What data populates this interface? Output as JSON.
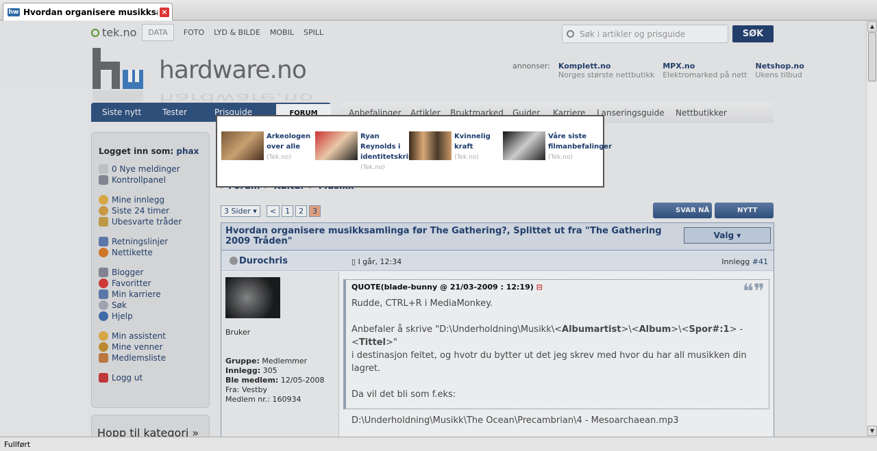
{
  "browser": {
    "tab_title": "Hvordan organisere musikksamlin...",
    "status": "Fullført"
  },
  "topnav": {
    "logo": "tek.no",
    "items": [
      "DATA",
      "FOTO",
      "LYD & BILDE",
      "MOBIL",
      "SPILL"
    ]
  },
  "search": {
    "placeholder": "Søk i artikler og prisguide",
    "button": "SØK"
  },
  "site": {
    "name": "hardware.no"
  },
  "ads": {
    "label": "annonser:",
    "items": [
      {
        "name": "Komplett.no",
        "desc": "Norges største nettbutikk"
      },
      {
        "name": "MPX.no",
        "desc": "Elektromarked på nett"
      },
      {
        "name": "Netshop.no",
        "desc": "Ukens tilbud"
      }
    ]
  },
  "nav": {
    "dark": [
      "Siste nytt",
      "Tester",
      "Prisguide"
    ],
    "forum": "FORUM",
    "light": [
      "Anbefalinger",
      "Artikler",
      "Bruktmarked",
      "Guider",
      "Karriere",
      "Lanseringsguide",
      "Nettbutikker"
    ]
  },
  "dropdown": [
    {
      "caption": "Arkeologen over alle",
      "src": "(Tek.no)"
    },
    {
      "caption": "Ryan Reynolds i identitetskrise",
      "src": "(Tek.no)"
    },
    {
      "caption": "Kvinnelig kraft",
      "src": "(Tek.no)"
    },
    {
      "caption": "Våre siste filmanbefalinger",
      "src": "(Tek.no)"
    }
  ],
  "sidebar": {
    "login_label": "Logget inn som:",
    "user": "phax",
    "links": [
      "0 Nye meldinger",
      "Kontrollpanel",
      "Mine innlegg",
      "Siste 24 timer",
      "Ubesvarte tråder",
      "Retningslinjer",
      "Nettikette",
      "Blogger",
      "Favoritter",
      "Min karriere",
      "Søk",
      "Hjelp",
      "Min assistent",
      "Mine venner",
      "Medlemsliste",
      "Logg ut"
    ],
    "jump": "Hopp til kategori »"
  },
  "breadcrumb": [
    "Forum",
    "Kultur",
    "Musikk"
  ],
  "pager": {
    "pages_label": "3 Sider",
    "prev": "<",
    "pages": [
      "1",
      "2",
      "3"
    ],
    "current": "3"
  },
  "actions": {
    "reply": "SVAR NÅ",
    "new_topic": "NYTT EMNE"
  },
  "post": {
    "title": "Hvordan organisere musikksamlinga før The Gathering?, Splittet ut fra \"The Gathering 2009 Tråden\"",
    "options": "Valg",
    "author": "Durochris",
    "time": "I går, 12:34",
    "count_label": "Innlegg",
    "count": "#41",
    "role": "Bruker",
    "group_label": "Gruppe:",
    "group": "Medlemmer",
    "posts_label": "Innlegg:",
    "posts": "305",
    "member_label": "Ble medlem:",
    "member": "12/05-2008",
    "from": "Fra: Vestby",
    "number": "Medlem nr.: 160934",
    "quote_title": "QUOTE(blade-bunny @ 21/03-2009 : 12:19)",
    "q1": "Rudde, CTRL+R i MediaMonkey.",
    "q2a": "Anbefaler å skrive \"D:\\Underholdning\\Musikk\\<",
    "q2b": "Albumartist",
    "q2c": ">\\<",
    "q2d": "Album",
    "q2e": ">\\<",
    "q2f": "Spor#:1",
    "q2g": "> - <",
    "q2h": "Tittel",
    "q2i": ">\"",
    "q3": "i destinasjon feltet, og hvotr du bytter ut det jeg skrev med hvor du har all musikken din lagret.",
    "q4": "Da vil det bli som f.eks:",
    "q5": "D:\\Underholdning\\Musikk\\The Ocean\\Precambrian\\4 - Mesoarchaean.mp3"
  }
}
